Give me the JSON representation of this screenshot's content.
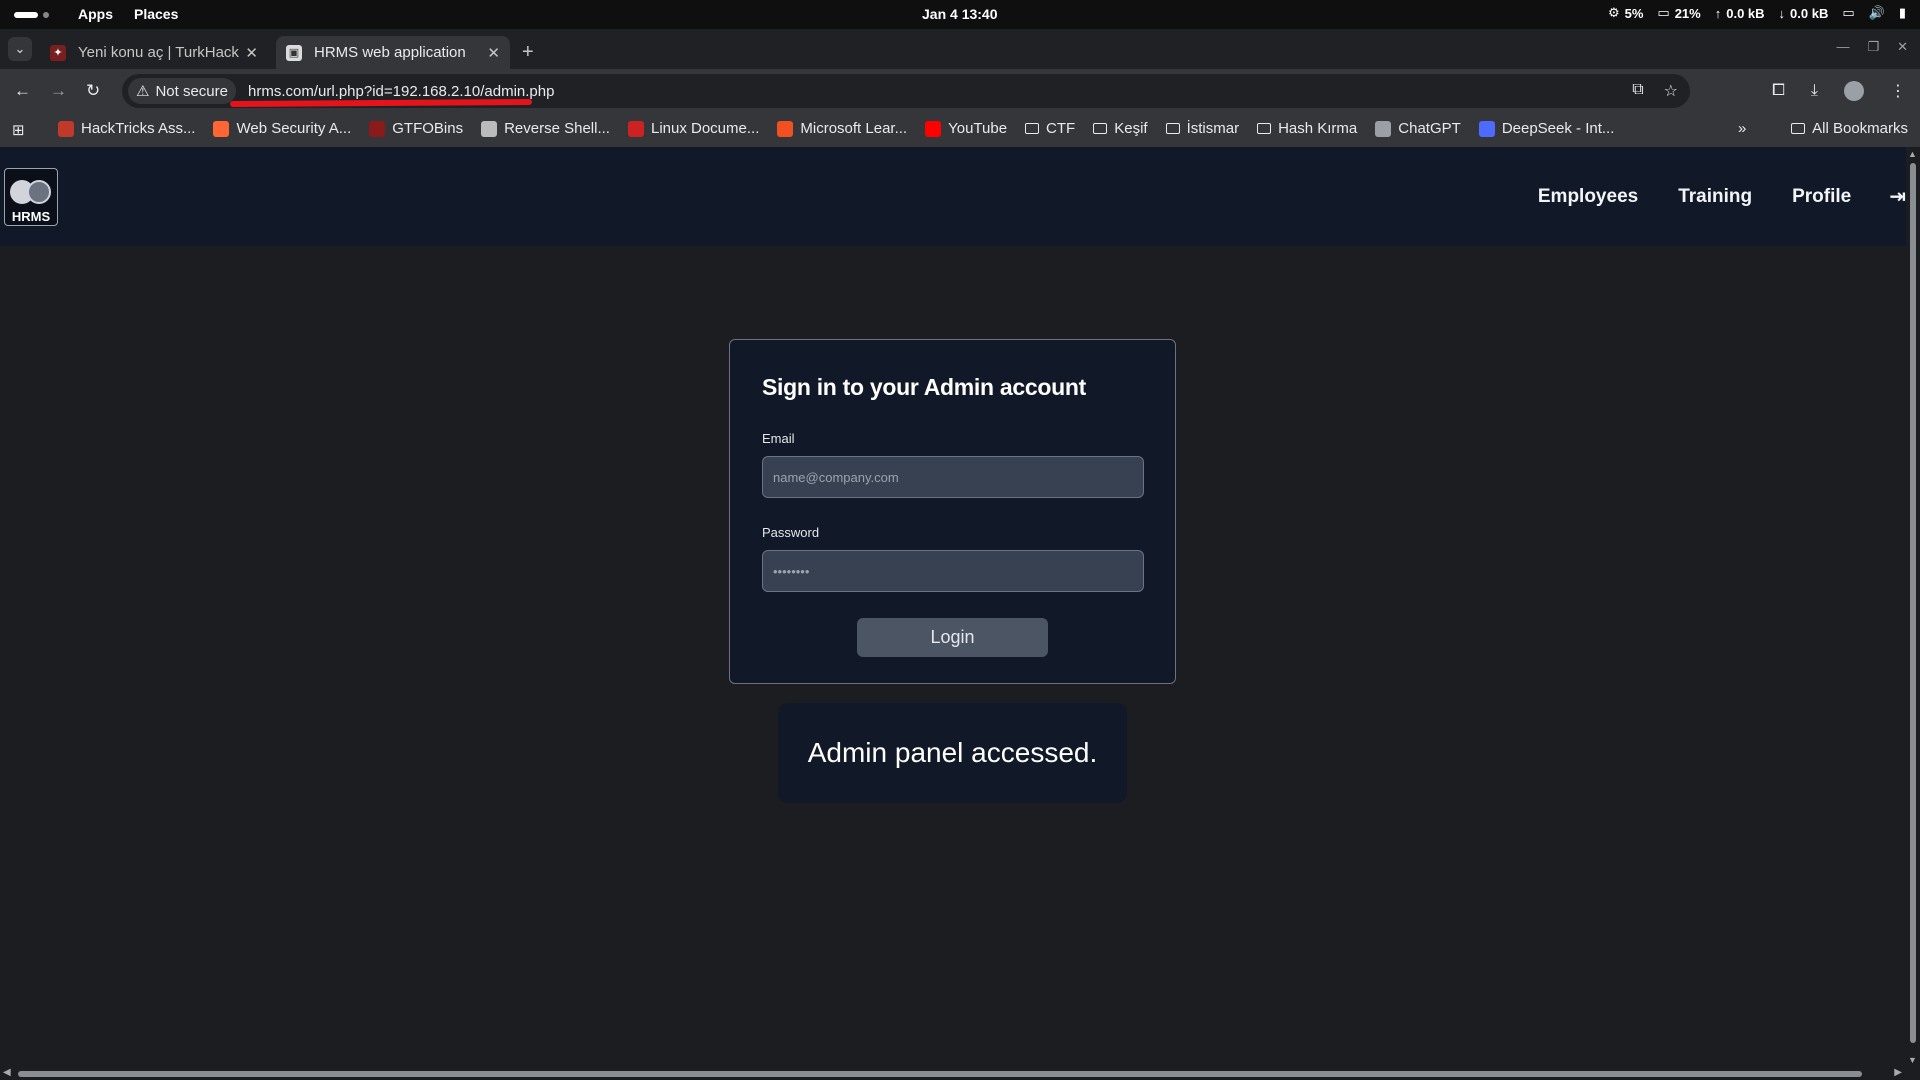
{
  "system_bar": {
    "apps": "Apps",
    "places": "Places",
    "clock": "Jan 4  13:40",
    "cpu": "5%",
    "memory": "21%",
    "upload": "0.0 kB",
    "download": "0.0 kB"
  },
  "browser": {
    "tabs": [
      {
        "title": "Yeni konu aç | TurkHackT",
        "favicon": "turkhack-icon",
        "active": false
      },
      {
        "title": "HRMS web application",
        "favicon": "hrms-icon",
        "active": true
      }
    ],
    "security_label": "Not secure",
    "url": "hrms.com/url.php?id=192.168.2.10/admin.php",
    "bookmarks": [
      {
        "label": "HackTricks Ass...",
        "icon": "hacktricks-icon",
        "color": "#c0392b"
      },
      {
        "label": "Web Security A...",
        "icon": "portswigger-icon",
        "color": "#ff6633"
      },
      {
        "label": "GTFOBins",
        "icon": "gtfobins-icon",
        "color": "#8b1a1a"
      },
      {
        "label": "Reverse Shell...",
        "icon": "skull-icon",
        "color": "#bbbbbb"
      },
      {
        "label": "Linux Docume...",
        "icon": "linux-docs-icon",
        "color": "#cc2222"
      },
      {
        "label": "Microsoft Lear...",
        "icon": "microsoft-icon",
        "color": "#f25022"
      },
      {
        "label": "YouTube",
        "icon": "youtube-icon",
        "color": "#ff0000"
      },
      {
        "label": "CTF",
        "icon": "folder-icon",
        "color": ""
      },
      {
        "label": "Keşif",
        "icon": "folder-icon",
        "color": ""
      },
      {
        "label": "İstismar",
        "icon": "folder-icon",
        "color": ""
      },
      {
        "label": "Hash Kırma",
        "icon": "folder-icon",
        "color": ""
      },
      {
        "label": "ChatGPT",
        "icon": "chatgpt-icon",
        "color": "#9aa0a6"
      },
      {
        "label": "DeepSeek - Int...",
        "icon": "deepseek-icon",
        "color": "#4d6bfe"
      }
    ],
    "all_bookmarks": "All Bookmarks"
  },
  "site": {
    "logo_text": "HRMS",
    "nav": {
      "employees": "Employees",
      "training": "Training",
      "profile": "Profile"
    },
    "login": {
      "title": "Sign in to your Admin account",
      "email_label": "Email",
      "email_placeholder": "name@company.com",
      "password_label": "Password",
      "password_value": "••••••••",
      "button": "Login"
    },
    "toast": "Admin panel accessed."
  },
  "colors": {
    "nav_bg": "#111827",
    "page_bg": "#1c1d20",
    "url_annotation": "#e6131a"
  }
}
